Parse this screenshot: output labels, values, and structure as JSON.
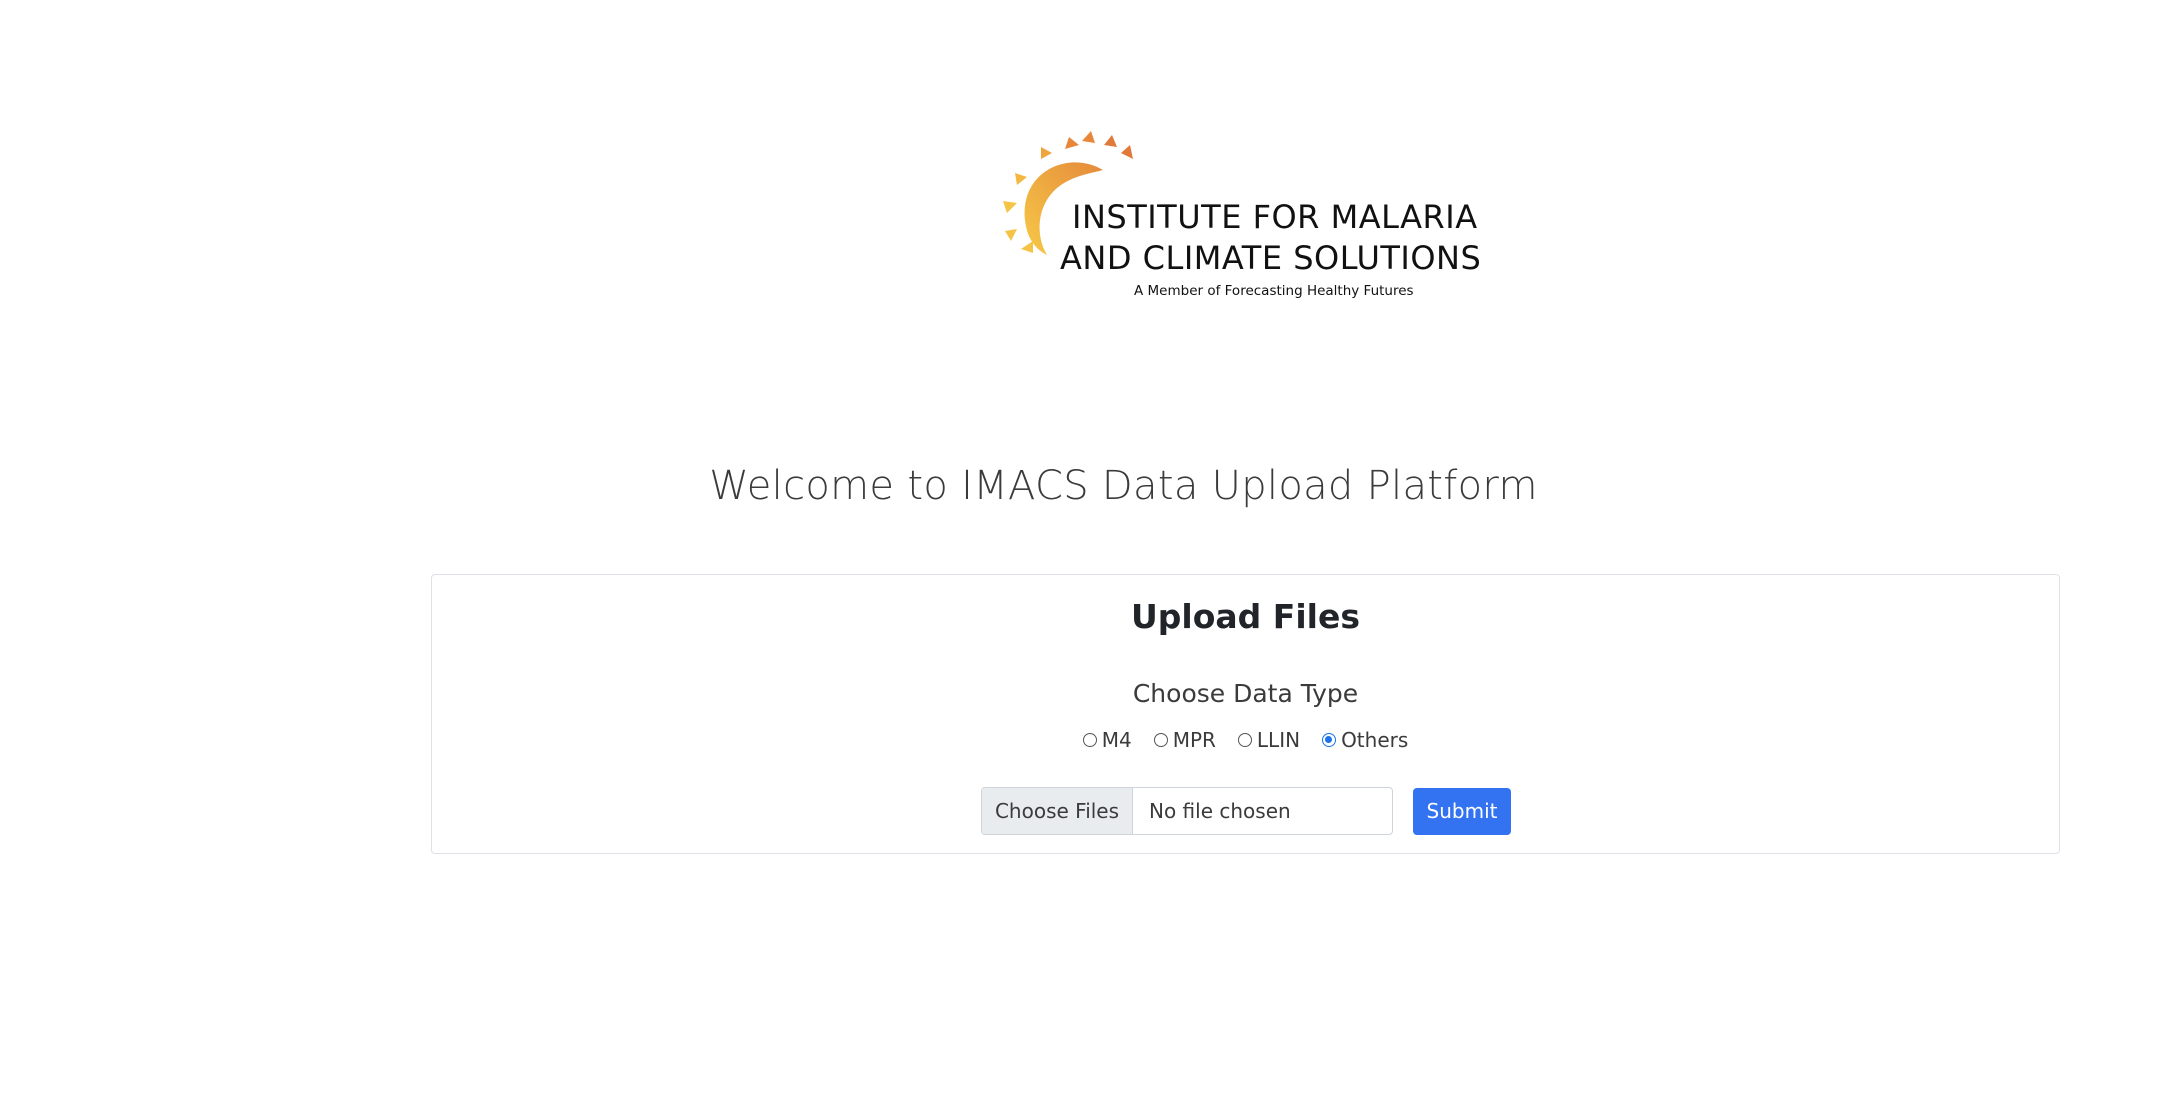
{
  "logo": {
    "line1": "INSTITUTE FOR MALARIA",
    "line2": "AND CLIMATE SOLUTIONS",
    "tagline": "A Member of Forecasting Healthy Futures",
    "colors": {
      "sun_light": "#f6c445",
      "sun_dark": "#e07b39"
    }
  },
  "welcome": "Welcome to IMACS Data Upload Platform",
  "card": {
    "title": "Upload Files",
    "choose_label": "Choose Data Type",
    "options": [
      {
        "label": "M4",
        "checked": false
      },
      {
        "label": "MPR",
        "checked": false
      },
      {
        "label": "LLIN",
        "checked": false
      },
      {
        "label": "Others",
        "checked": true
      }
    ],
    "file_button": "Choose Files",
    "file_status": "No file chosen",
    "submit_label": "Submit"
  },
  "colors": {
    "accent": "#3373f2",
    "radio_checked": "#1a73e8"
  }
}
